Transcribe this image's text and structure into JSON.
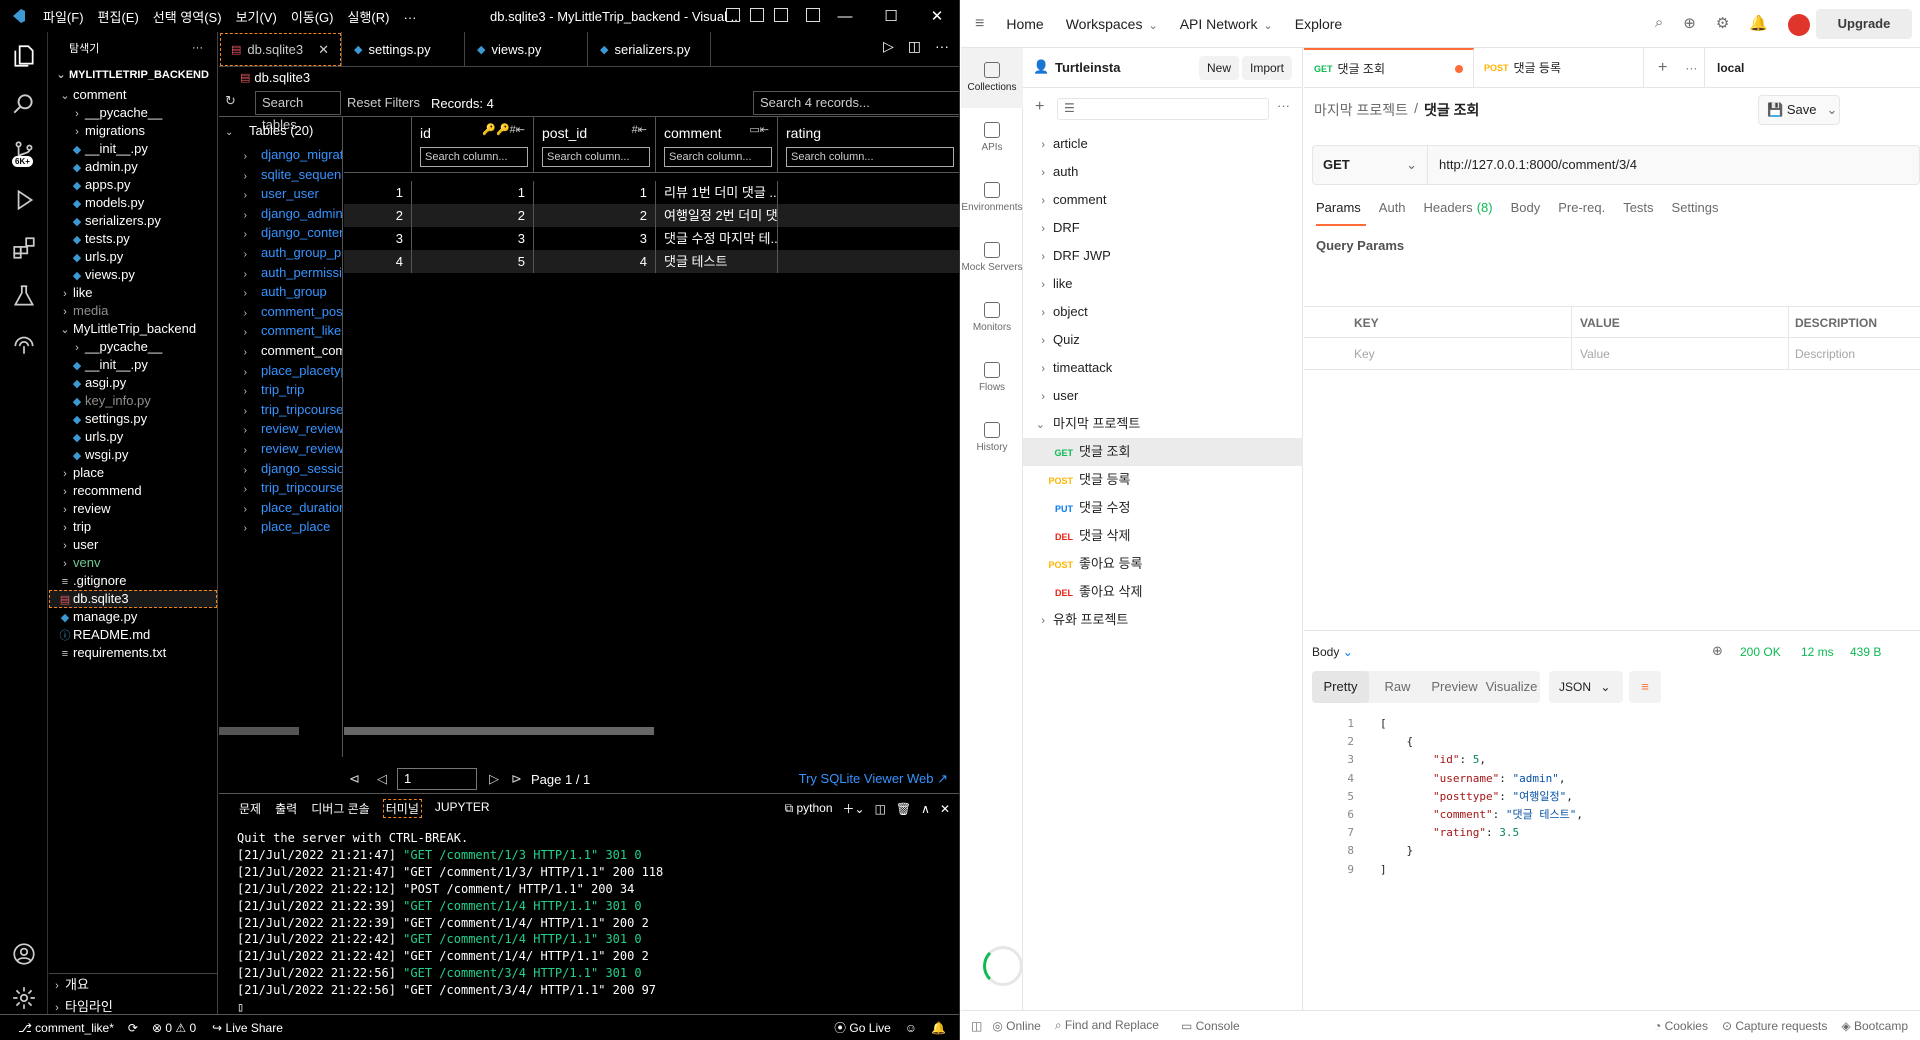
{
  "vscode": {
    "menu": [
      "파일(F)",
      "편집(E)",
      "선택 영역(S)",
      "보기(V)",
      "이동(G)",
      "실행(R)",
      "···"
    ],
    "window_title": "db.sqlite3 - MyLittleTrip_backend - Visual ...",
    "activity_badge": "6K+",
    "explorer_title": "탐색기",
    "explorer_root": "MYLITTLETRIP_BACKEND",
    "tree": [
      {
        "label": "comment",
        "type": "folder-open"
      },
      {
        "label": "__pycache__",
        "type": "folder"
      },
      {
        "label": "migrations",
        "type": "folder"
      },
      {
        "label": "__init__.py",
        "type": "py"
      },
      {
        "label": "admin.py",
        "type": "py"
      },
      {
        "label": "apps.py",
        "type": "py"
      },
      {
        "label": "models.py",
        "type": "py"
      },
      {
        "label": "serializers.py",
        "type": "py"
      },
      {
        "label": "tests.py",
        "type": "py"
      },
      {
        "label": "urls.py",
        "type": "py"
      },
      {
        "label": "views.py",
        "type": "py"
      },
      {
        "label": "like",
        "type": "folder"
      },
      {
        "label": "media",
        "type": "folder"
      },
      {
        "label": "MyLittleTrip_backend",
        "type": "folder-open"
      },
      {
        "label": "__pycache__",
        "type": "folder"
      },
      {
        "label": "__init__.py",
        "type": "py"
      },
      {
        "label": "asgi.py",
        "type": "py"
      },
      {
        "label": "key_info.py",
        "type": "py"
      },
      {
        "label": "settings.py",
        "type": "py"
      },
      {
        "label": "urls.py",
        "type": "py"
      },
      {
        "label": "wsgi.py",
        "type": "py"
      },
      {
        "label": "place",
        "type": "folder"
      },
      {
        "label": "recommend",
        "type": "folder"
      },
      {
        "label": "review",
        "type": "folder"
      },
      {
        "label": "trip",
        "type": "folder"
      },
      {
        "label": "user",
        "type": "folder"
      },
      {
        "label": "venv",
        "type": "folder"
      },
      {
        "label": ".gitignore",
        "type": "file"
      },
      {
        "label": "db.sqlite3",
        "type": "db"
      },
      {
        "label": "manage.py",
        "type": "py"
      },
      {
        "label": "README.md",
        "type": "md"
      },
      {
        "label": "requirements.txt",
        "type": "txt"
      }
    ],
    "outline_label": "개요",
    "timeline_label": "타임라인",
    "tabs": [
      "db.sqlite3",
      "settings.py",
      "views.py",
      "serializers.py"
    ],
    "breadcrumb": "db.sqlite3",
    "db": {
      "search_tables": "Search tables",
      "reset_filters": "Reset Filters",
      "records": "Records: 4",
      "search_records": "Search 4 records...",
      "tables_header": "Tables (20)",
      "tables": [
        "django_migrat",
        "sqlite_sequenc",
        "user_user",
        "django_admin",
        "django_conten",
        "auth_group_p",
        "auth_permissi",
        "auth_group",
        "comment_pos",
        "comment_like",
        "comment_com",
        "place_placetyp",
        "trip_trip",
        "trip_tripcourse",
        "review_review",
        "review_reviewi",
        "django_sessio",
        "trip_tripcourse",
        "place_duration",
        "place_place"
      ],
      "columns": [
        "id",
        "post_id",
        "comment",
        "rating"
      ],
      "search_column": "Search column...",
      "rows": [
        {
          "row": "1",
          "id": "1",
          "post_id": "1",
          "comment": "리뷰 1번 더미 댓글 ...",
          "rating": ""
        },
        {
          "row": "2",
          "id": "2",
          "post_id": "2",
          "comment": "여행일정 2번 더미 댓...",
          "rating": ""
        },
        {
          "row": "3",
          "id": "3",
          "post_id": "3",
          "comment": "댓글 수정 마지막 테...",
          "rating": ""
        },
        {
          "row": "4",
          "id": "5",
          "post_id": "4",
          "comment": "댓글 테스트",
          "rating": ""
        }
      ],
      "page_input": "1",
      "page_label": "Page 1 / 1",
      "try_link": "Try SQLite Viewer Web ↗"
    },
    "panel_tabs": [
      "문제",
      "출력",
      "디버그 콘솔",
      "터미널",
      "JUPYTER"
    ],
    "panel_shell": "python",
    "terminal": [
      {
        "text": "Quit the server with CTRL-BREAK.",
        "color": "#ffffff"
      },
      {
        "text": "[21/Jul/2022 21:21:47] ",
        "rest": "\"GET /comment/1/3 HTTP/1.1\" 301 0",
        "color": "#23d18b"
      },
      {
        "text": "[21/Jul/2022 21:21:47] ",
        "rest": "\"GET /comment/1/3/ HTTP/1.1\" 200 118",
        "color": "#ffffff"
      },
      {
        "text": "[21/Jul/2022 21:22:12] ",
        "rest": "\"POST /comment/ HTTP/1.1\" 200 34",
        "color": "#ffffff"
      },
      {
        "text": "[21/Jul/2022 21:22:39] ",
        "rest": "\"GET /comment/1/4 HTTP/1.1\" 301 0",
        "color": "#23d18b"
      },
      {
        "text": "[21/Jul/2022 21:22:39] ",
        "rest": "\"GET /comment/1/4/ HTTP/1.1\" 200 2",
        "color": "#ffffff"
      },
      {
        "text": "[21/Jul/2022 21:22:42] ",
        "rest": "\"GET /comment/1/4 HTTP/1.1\" 301 0",
        "color": "#23d18b"
      },
      {
        "text": "[21/Jul/2022 21:22:42] ",
        "rest": "\"GET /comment/1/4/ HTTP/1.1\" 200 2",
        "color": "#ffffff"
      },
      {
        "text": "[21/Jul/2022 21:22:56] ",
        "rest": "\"GET /comment/3/4 HTTP/1.1\" 301 0",
        "color": "#23d18b"
      },
      {
        "text": "[21/Jul/2022 21:22:56] ",
        "rest": "\"GET /comment/3/4/ HTTP/1.1\" 200 97",
        "color": "#ffffff"
      }
    ],
    "status": {
      "branch": "comment_like*",
      "errors": "0",
      "warnings": "0",
      "live_share": "Live Share",
      "go_live": "Go Live"
    }
  },
  "postman": {
    "nav": [
      "Home",
      "Workspaces",
      "API Network",
      "Explore"
    ],
    "upgrade": "Upgrade",
    "workspace": "Turtleinsta",
    "new_btn": "New",
    "import_btn": "Import",
    "sidebar": [
      "Collections",
      "APIs",
      "Environments",
      "Mock Servers",
      "Monitors",
      "Flows",
      "History"
    ],
    "collections": [
      "article",
      "auth",
      "comment",
      "DRF",
      "DRF JWP",
      "like",
      "object",
      "Quiz",
      "timeattack",
      "user"
    ],
    "open_collection": "마지막 프로젝트",
    "requests": [
      {
        "method": "GET",
        "name": "댓글 조회",
        "color": "#0cbb52"
      },
      {
        "method": "POST",
        "name": "댓글 등록",
        "color": "#ffb400"
      },
      {
        "method": "PUT",
        "name": "댓글 수정",
        "color": "#097bed"
      },
      {
        "method": "DEL",
        "name": "댓글 삭제",
        "color": "#eb2013"
      },
      {
        "method": "POST",
        "name": "좋아요 등록",
        "color": "#ffb400"
      },
      {
        "method": "DEL",
        "name": "좋아요 삭제",
        "color": "#eb2013"
      }
    ],
    "last_collection": "유화 프로젝트",
    "tabs": [
      {
        "method": "GET",
        "name": "댓글 조회",
        "color": "#0cbb52"
      },
      {
        "method": "POST",
        "name": "댓글 등록",
        "color": "#ffb400"
      }
    ],
    "env": "local",
    "breadcrumb_parent": "마지막 프로젝트",
    "breadcrumb_current": "댓글 조회",
    "save": "Save",
    "method": "GET",
    "url": "http://127.0.0.1:8000/comment/3/4",
    "req_tabs": [
      "Params",
      "Auth",
      "Headers",
      "Body",
      "Pre-req.",
      "Tests",
      "Settings"
    ],
    "headers_count": "(8)",
    "query_params": "Query Params",
    "kv_headers": [
      "KEY",
      "VALUE",
      "DESCRIPTION"
    ],
    "kv_placeholders": [
      "Key",
      "Value",
      "Description"
    ],
    "resp_label": "Body",
    "status": "200 OK",
    "time": "12 ms",
    "size": "439 B",
    "view_tabs": [
      "Pretty",
      "Raw",
      "Preview",
      "Visualize"
    ],
    "format": "JSON",
    "json_lines": [
      {
        "n": "1",
        "t": "["
      },
      {
        "n": "2",
        "t": "    {"
      },
      {
        "n": "3",
        "k": "\"id\"",
        "v": "5",
        "vt": "n"
      },
      {
        "n": "4",
        "k": "\"username\"",
        "v": "\"admin\"",
        "vt": "s"
      },
      {
        "n": "5",
        "k": "\"posttype\"",
        "v": "\"여행일정\"",
        "vt": "s"
      },
      {
        "n": "6",
        "k": "\"comment\"",
        "v": "\"댓글 테스트\"",
        "vt": "s"
      },
      {
        "n": "7",
        "k": "\"rating\"",
        "v": "3.5",
        "vt": "n",
        "last": true
      },
      {
        "n": "8",
        "t": "    }"
      },
      {
        "n": "9",
        "t": "]"
      }
    ],
    "status_bar": [
      "Online",
      "Find and Replace",
      "Console",
      "Cookies",
      "Capture requests",
      "Bootcamp"
    ]
  }
}
